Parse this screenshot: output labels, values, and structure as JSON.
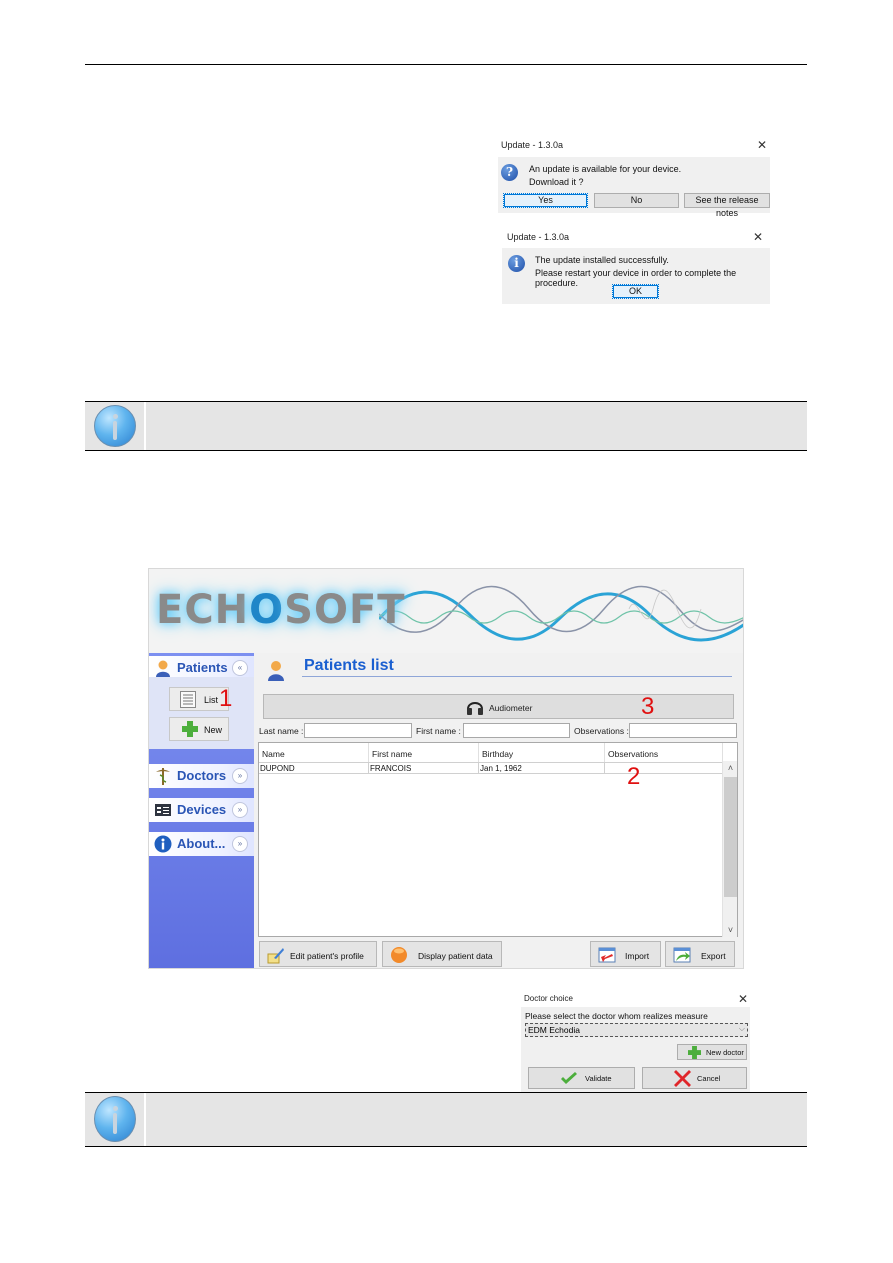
{
  "update_dialog": {
    "title": "Update - 1.3.0a",
    "message_line1": "An update is available for your device.",
    "message_line2": "Download it ?",
    "icon": "question-icon",
    "buttons": [
      "Yes",
      "No",
      "See the release notes"
    ]
  },
  "update_success_dialog": {
    "title": "Update - 1.3.0a",
    "message_line1": "The update installed successfully.",
    "message_line2": "Please restart your device in order to complete the procedure.",
    "icon": "info-icon",
    "ok_label": "OK"
  },
  "notes": [
    {
      "icon": "info-icon"
    },
    {
      "icon": "info-icon"
    }
  ],
  "echosoft": {
    "logo_prefix": "ECH",
    "logo_o": "O",
    "logo_suffix": "SOFT",
    "sidebar": [
      {
        "label": "Patients",
        "icon": "patient-icon",
        "expanded": true,
        "chevron": "«"
      },
      {
        "label": "Doctors",
        "icon": "caduceus-icon",
        "expanded": false,
        "chevron": "»"
      },
      {
        "label": "Devices",
        "icon": "device-icon",
        "expanded": false,
        "chevron": "»"
      },
      {
        "label": "About...",
        "icon": "info-icon",
        "expanded": false,
        "chevron": "»"
      }
    ],
    "patients_panel": {
      "list_label": "List",
      "new_label": "New"
    },
    "page_title": "Patients list",
    "audiometer_label": "Audiometer",
    "filters": {
      "last_name_label": "Last name :",
      "first_name_label": "First name :",
      "observations_label": "Observations :",
      "last_name_value": "",
      "first_name_value": "",
      "observations_value": ""
    },
    "table": {
      "columns": [
        "Name",
        "First name",
        "Birthday",
        "Observations"
      ],
      "rows": [
        [
          "DUPOND",
          "FRANCOIS",
          "Jan 1, 1962",
          ""
        ]
      ]
    },
    "bottom_buttons": {
      "edit": "Edit patient's profile",
      "display": "Display patient data",
      "import": "Import",
      "export": "Export"
    },
    "annotations": {
      "a1": "1",
      "a2": "2",
      "a3": "3"
    }
  },
  "doctor_dialog": {
    "title": "Doctor choice",
    "prompt": "Please select the doctor whom realizes measure",
    "selected_doctor": "EDM Echodia",
    "new_doctor_label": "New doctor",
    "validate_label": "Validate",
    "cancel_label": "Cancel"
  },
  "glyphs": {
    "close": "✕",
    "chevron_down": "⌵",
    "scroll_up": "˄",
    "scroll_down": "˅"
  }
}
